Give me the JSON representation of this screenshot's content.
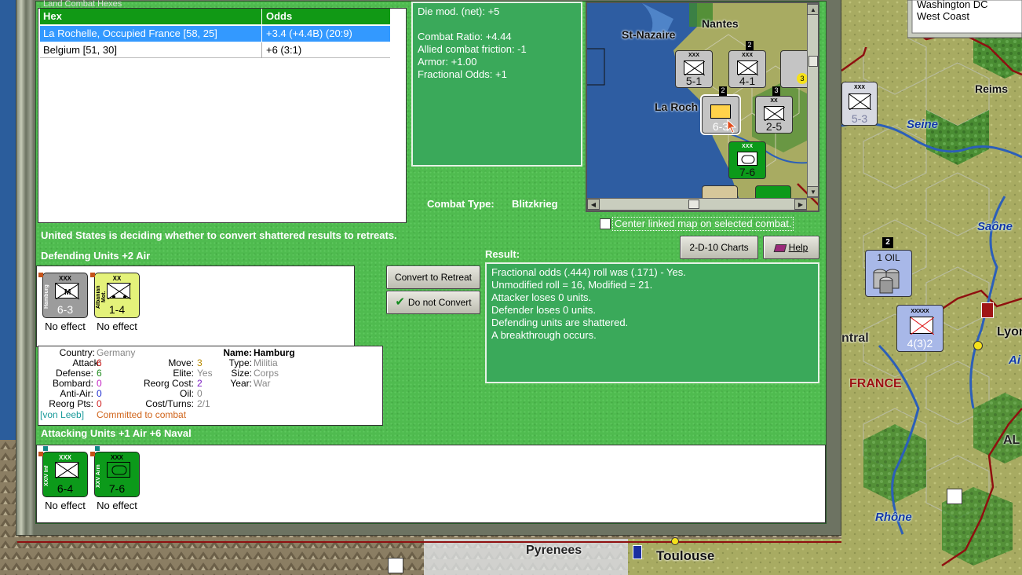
{
  "map": {
    "cities": [
      "Nantes",
      "St-Nazaire",
      "La Rochelle",
      "Reims",
      "Lyons",
      "Toulouse"
    ],
    "rivers": [
      "Seine",
      "Saône",
      "Rhône",
      "Ai"
    ],
    "country_label": "FRANCE",
    "region_labels": [
      "Pyrenees",
      "ntral",
      "AL"
    ],
    "oil_label": "1 OIL",
    "top_panel_lines": [
      "Washington DC",
      "West Coast"
    ]
  },
  "combat": {
    "hex_table": {
      "header_truncated": "Land Combat Hexes",
      "col_hex": "Hex",
      "col_odds": "Odds",
      "rows": [
        {
          "hex": "La Rochelle, Occupied France [58, 25]",
          "odds": "+3.4 (+4.4B) (20:9)",
          "selected": true
        },
        {
          "hex": "Belgium [51, 30]",
          "odds": "+6 (3:1)",
          "selected": false
        }
      ]
    },
    "modifiers": [
      "Die mod. (net): +5",
      "",
      "Combat Ratio: +4.44",
      "Allied combat friction: -1",
      "Armor: +1.00",
      "Fractional Odds: +1"
    ],
    "combat_type_label": "Combat Type:",
    "combat_type_value": "Blitzkrieg",
    "center_linked_label": "Center linked map on selected combat.",
    "status_message": "United States is deciding whether to convert shattered results to retreats.",
    "defending_title": "Defending Units +2 Air",
    "attacking_title": "Attacking Units +1 Air +6 Naval",
    "result_title": "Result:",
    "result_lines": [
      "Fractional odds (.444) roll was (.171)  - Yes.",
      "Unmodified roll = 16, Modified = 21.",
      "Attacker loses 0 units.",
      "Defender loses 0 units.",
      "Defending units are shattered.",
      "A breakthrough occurs."
    ],
    "buttons": {
      "charts": "2-D-10 Charts",
      "help": "Help",
      "convert": "Convert to Retreat",
      "not_convert": "Do not Convert"
    },
    "defending_units": [
      {
        "name": "Hamburg",
        "size": "XXX",
        "strength": "6-3",
        "result": "No effect",
        "color": "#9c9c9c"
      },
      {
        "name": "Albanian Mot.",
        "size": "XX",
        "strength": "1-4",
        "result": "No effect",
        "color": "#e4f27a"
      }
    ],
    "attacking_units": [
      {
        "name": "XXIV Inf",
        "size": "XXX",
        "strength": "6-4",
        "result": "No effect",
        "color": "#0c9a1a"
      },
      {
        "name": "XXV Arm",
        "size": "XXX",
        "strength": "7-6",
        "result": "No effect",
        "color": "#0c9a1a"
      }
    ],
    "info": {
      "country_label": "Country:",
      "country": "Germany",
      "attack_label": "Attack:",
      "attack": "6",
      "defense_label": "Defense:",
      "defense": "6",
      "bombard_label": "Bombard:",
      "bombard": "0",
      "antiair_label": "Anti-Air:",
      "antiair": "0",
      "reorg_pts_label": "Reorg Pts:",
      "reorg_pts": "0",
      "move_label": "Move:",
      "move": "3",
      "elite_label": "Elite:",
      "elite": "Yes",
      "reorg_cost_label": "Reorg Cost:",
      "reorg_cost": "2",
      "oil_label": "Oil:",
      "oil": "0",
      "cost_turns_label": "Cost/Turns:",
      "cost_turns": "2/1",
      "name_label": "Name:",
      "name": "Hamburg",
      "type_label": "Type:",
      "type": "Militia",
      "size_label": "Size:",
      "size": "Corps",
      "year_label": "Year:",
      "year": "War",
      "leader": "[von Leeb]",
      "status": "Committed to combat"
    },
    "minimap": {
      "city_labels": [
        "Nantes",
        "St-Nazaire",
        "La Roch"
      ],
      "counter_values": [
        "5-1",
        "4-1",
        "6-3",
        "2-5",
        "7-6"
      ]
    }
  },
  "colors": {
    "panel_green": "#4fbb4f",
    "header_green": "#119915",
    "selection_blue": "#3399ff",
    "result_box": "#3aa95a"
  }
}
